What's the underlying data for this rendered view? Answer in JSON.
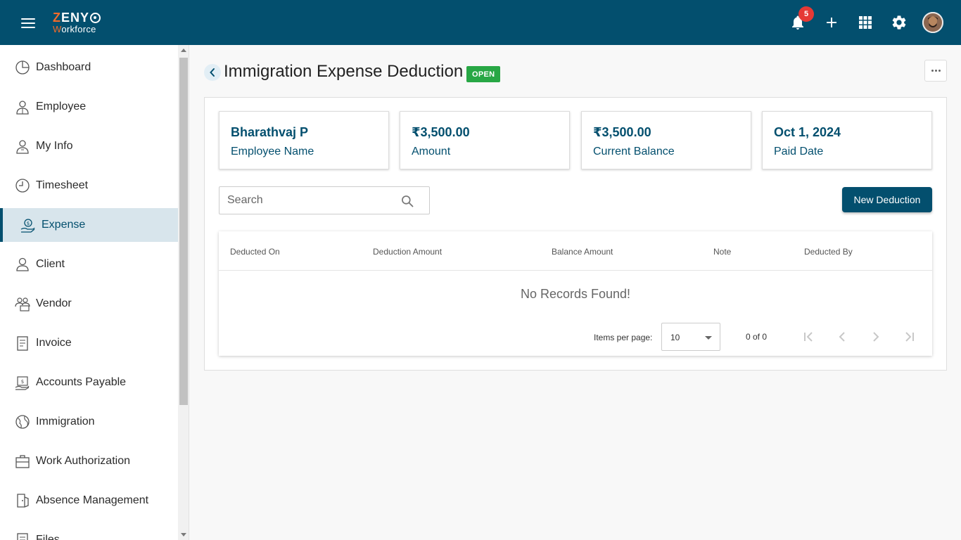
{
  "app": {
    "logo_top": "ZENY",
    "logo_bottom_w": "W",
    "logo_bottom_rest": "orkforce",
    "notification_count": "5"
  },
  "colors": {
    "primary": "#034f6e",
    "accent": "#f26b2a",
    "success": "#28a745",
    "danger": "#e53935"
  },
  "sidebar": {
    "items": [
      {
        "label": "Dashboard",
        "icon": "dashboard-icon"
      },
      {
        "label": "Employee",
        "icon": "employee-icon"
      },
      {
        "label": "My Info",
        "icon": "my-info-icon"
      },
      {
        "label": "Timesheet",
        "icon": "clock-icon"
      },
      {
        "label": "Expense",
        "icon": "expense-icon"
      },
      {
        "label": "Client",
        "icon": "client-icon"
      },
      {
        "label": "Vendor",
        "icon": "vendor-icon"
      },
      {
        "label": "Invoice",
        "icon": "invoice-icon"
      },
      {
        "label": "Accounts Payable",
        "icon": "accounts-payable-icon"
      },
      {
        "label": "Immigration",
        "icon": "globe-icon"
      },
      {
        "label": "Work Authorization",
        "icon": "briefcase-icon"
      },
      {
        "label": "Absence Management",
        "icon": "door-icon"
      },
      {
        "label": "Files",
        "icon": "files-icon"
      }
    ],
    "active_index": 4
  },
  "page": {
    "title": "Immigration Expense Deduction",
    "status": "OPEN"
  },
  "stats": [
    {
      "value": "Bharathvaj P",
      "label": "Employee Name"
    },
    {
      "value": "₹3,500.00",
      "label": "Amount"
    },
    {
      "value": "₹3,500.00",
      "label": "Current Balance"
    },
    {
      "value": "Oct 1, 2024",
      "label": "Paid Date"
    }
  ],
  "search": {
    "placeholder": "Search",
    "value": ""
  },
  "actions": {
    "new_deduction": "New Deduction"
  },
  "table": {
    "columns": [
      "Deducted On",
      "Deduction Amount",
      "Balance Amount",
      "Note",
      "Deducted By"
    ],
    "rows": [],
    "empty_message": "No Records Found!"
  },
  "pagination": {
    "items_per_page_label": "Items per page:",
    "items_per_page": "10",
    "range": "0 of 0"
  }
}
